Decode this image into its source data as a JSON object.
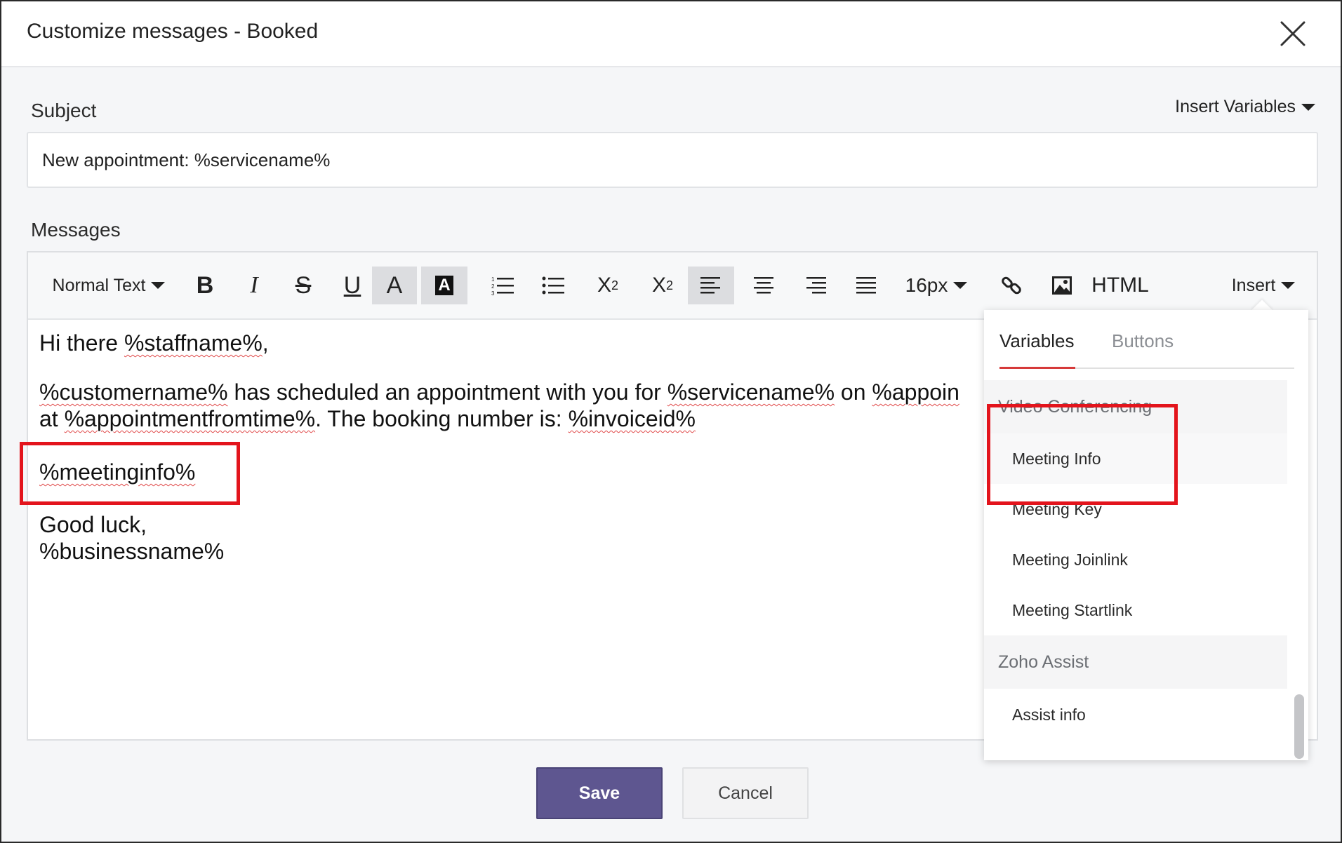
{
  "modal": {
    "title": "Customize messages - Booked"
  },
  "subject": {
    "label": "Subject",
    "insert_variables": "Insert Variables",
    "value": "New appointment: %servicename%"
  },
  "messages": {
    "label": "Messages",
    "toolbar": {
      "text_style": "Normal Text",
      "bold": "B",
      "italic": "I",
      "strike": "S",
      "underline": "U",
      "font_color": "A",
      "bg_color": "A",
      "subscript": "X",
      "subscript_sub": "2",
      "superscript": "X",
      "superscript_sup": "2",
      "font_size": "16px",
      "html": "HTML",
      "insert": "Insert"
    },
    "body": {
      "line1_prefix": "Hi there ",
      "line1_var": "%staffname%",
      "line1_suffix": ",",
      "line2_var1": "%customername%",
      "line2_text1": " has scheduled an appointment with you for ",
      "line2_var2": "%servicename%",
      "line2_text2": " on ",
      "line2_var3": "%appoin",
      "line3_prefix": "at ",
      "line3_var1": "%appointmentfromtime%",
      "line3_text1": ". The booking number is: ",
      "line3_var2": "%invoiceid%",
      "line4_var": "%meetinginfo%",
      "line5": "Good luck,",
      "line6": "%businessname%"
    }
  },
  "insert_dropdown": {
    "tabs": [
      "Variables",
      "Buttons"
    ],
    "active_tab": "Variables",
    "groups": [
      {
        "title": "Video Conferencing",
        "items": [
          "Meeting Info",
          "Meeting Key",
          "Meeting Joinlink",
          "Meeting Startlink"
        ]
      },
      {
        "title": "Zoho Assist",
        "items": [
          "Assist info"
        ]
      }
    ]
  },
  "footer": {
    "save": "Save",
    "cancel": "Cancel"
  },
  "colors": {
    "primary_button": "#5e5690",
    "highlight": "#e3141c",
    "active_tab_underline": "#d63a3a"
  }
}
